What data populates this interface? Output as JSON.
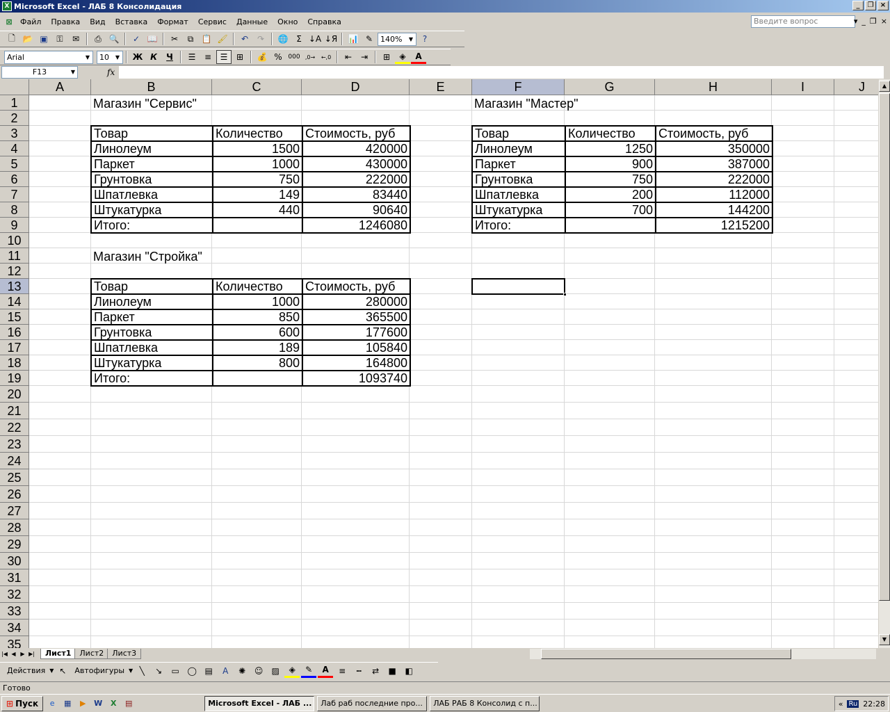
{
  "window": {
    "title": "Microsoft Excel - ЛАБ 8 Консолидация",
    "minimize": "_",
    "restore": "❐",
    "close": "×"
  },
  "menu": [
    "Файл",
    "Правка",
    "Вид",
    "Вставка",
    "Формат",
    "Сервис",
    "Данные",
    "Окно",
    "Справка"
  ],
  "help_placeholder": "Введите вопрос",
  "toolbar": {
    "zoom": "140%",
    "font": "Arial",
    "font_size": "10"
  },
  "formula": {
    "name_box": "F13",
    "fx_label": "fx",
    "content": ""
  },
  "columns": [
    "A",
    "B",
    "C",
    "D",
    "E",
    "F",
    "G",
    "H",
    "I",
    "J"
  ],
  "selected_column": "F",
  "rows": [
    "1",
    "2",
    "3",
    "4",
    "5",
    "6",
    "7",
    "8",
    "9",
    "10",
    "11",
    "12",
    "13",
    "14",
    "15",
    "16",
    "17",
    "18",
    "19",
    "20",
    "21",
    "22",
    "23",
    "24",
    "25",
    "26",
    "27",
    "28",
    "29",
    "30",
    "31",
    "32",
    "33",
    "34",
    "35"
  ],
  "selected_row": "13",
  "active_cell": "F13",
  "stores": [
    {
      "title": "Магазин \"Сервис\"",
      "headers": [
        "Товар",
        "Количество",
        "Стоимость, руб"
      ],
      "rows": [
        [
          "Линолеум",
          "1500",
          "420000"
        ],
        [
          "Паркет",
          "1000",
          "430000"
        ],
        [
          "Грунтовка",
          "750",
          "222000"
        ],
        [
          "Шпатлевка",
          "149",
          "83440"
        ],
        [
          "Штукатурка",
          "440",
          "90640"
        ],
        [
          "Итого:",
          "",
          "1246080"
        ]
      ]
    },
    {
      "title": "Магазин \"Мастер\"",
      "headers": [
        "Товар",
        "Количество",
        "Стоимость, руб"
      ],
      "rows": [
        [
          "Линолеум",
          "1250",
          "350000"
        ],
        [
          "Паркет",
          "900",
          "387000"
        ],
        [
          "Грунтовка",
          "750",
          "222000"
        ],
        [
          "Шпатлевка",
          "200",
          "112000"
        ],
        [
          "Штукатурка",
          "700",
          "144200"
        ],
        [
          "Итого:",
          "",
          "1215200"
        ]
      ]
    },
    {
      "title": "Магазин \"Стройка\"",
      "headers": [
        "Товар",
        "Количество",
        "Стоимость, руб"
      ],
      "rows": [
        [
          "Линолеум",
          "1000",
          "280000"
        ],
        [
          "Паркет",
          "850",
          "365500"
        ],
        [
          "Грунтовка",
          "600",
          "177600"
        ],
        [
          "Шпатлевка",
          "189",
          "105840"
        ],
        [
          "Штукатурка",
          "800",
          "164800"
        ],
        [
          "Итого:",
          "",
          "1093740"
        ]
      ]
    }
  ],
  "sheets": [
    "Лист1",
    "Лист2",
    "Лист3"
  ],
  "active_sheet": "Лист1",
  "drawing": {
    "actions": "Действия",
    "autoshapes": "Автофигуры"
  },
  "status": "Готово",
  "taskbar": {
    "start": "Пуск",
    "buttons": [
      "Microsoft Excel - ЛАБ ...",
      "Лаб раб последние про...",
      "ЛАБ РАБ 8 Консолид с п..."
    ],
    "lang": "Ru",
    "time": "22:28"
  }
}
